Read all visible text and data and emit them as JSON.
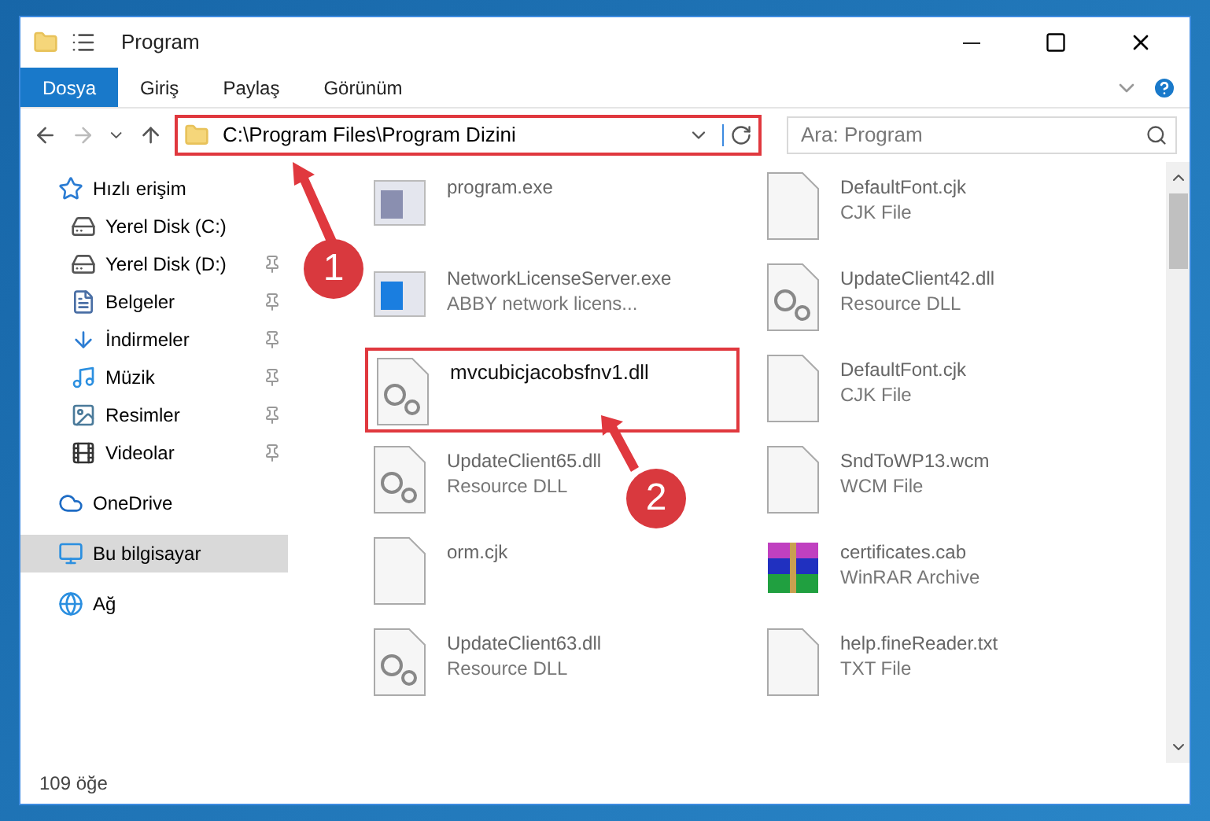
{
  "window": {
    "title": "Program"
  },
  "ribbon_tabs": [
    {
      "label": "Dosya",
      "selected": true
    },
    {
      "label": "Giriş",
      "selected": false
    },
    {
      "label": "Paylaş",
      "selected": false
    },
    {
      "label": "Görünüm",
      "selected": false
    }
  ],
  "address": {
    "path": "C:\\Program Files\\Program Dizini"
  },
  "search": {
    "placeholder": "Ara: Program"
  },
  "sidebar": {
    "items": [
      {
        "label": "Hızlı erişim",
        "kind": "star",
        "selected": false,
        "children": [
          {
            "label": "Yerel Disk (C:)",
            "kind": "drive",
            "pinned": false,
            "selected": false
          },
          {
            "label": "Yerel Disk (D:)",
            "kind": "drive",
            "pinned": true,
            "selected": false
          },
          {
            "label": "Belgeler",
            "kind": "docs",
            "pinned": true,
            "selected": false
          },
          {
            "label": "İndirmeler",
            "kind": "download",
            "pinned": true,
            "selected": false
          },
          {
            "label": "Müzik",
            "kind": "music",
            "pinned": true,
            "selected": false
          },
          {
            "label": "Resimler",
            "kind": "pictures",
            "pinned": true,
            "selected": false
          },
          {
            "label": "Videolar",
            "kind": "video",
            "pinned": true,
            "selected": false
          }
        ]
      },
      {
        "label": "OneDrive",
        "kind": "cloud",
        "selected": false
      },
      {
        "label": "Bu bilgisayar",
        "kind": "pc",
        "selected": true
      },
      {
        "label": "Ağ",
        "kind": "network",
        "selected": false
      }
    ]
  },
  "files": [
    {
      "name": "program.exe",
      "kind": "exe",
      "highlighted": false
    },
    {
      "name": "DefaultFont.cjk",
      "type": "CJK File",
      "kind": "blank",
      "highlighted": false
    },
    {
      "name": "NetworkLicenseServer.exe",
      "type": "ABBY network licens...",
      "kind": "app",
      "highlighted": false
    },
    {
      "name": "UpdateClient42.dll",
      "type": "Resource DLL",
      "kind": "dll",
      "highlighted": false
    },
    {
      "name": "mvcubicjacobsfnv1.dll",
      "kind": "dll",
      "highlighted": true
    },
    {
      "name": "DefaultFont.cjk",
      "type": "CJK File",
      "kind": "blank",
      "highlighted": false
    },
    {
      "name": "UpdateClient65.dll",
      "type": "Resource DLL",
      "kind": "dll",
      "highlighted": false
    },
    {
      "name": "SndToWP13.wcm",
      "type": "WCM File",
      "kind": "blank",
      "highlighted": false
    },
    {
      "name": "orm.cjk",
      "kind": "blank",
      "highlighted": false
    },
    {
      "name": "certificates.cab",
      "type": "WinRAR Archive",
      "kind": "archive",
      "highlighted": false
    },
    {
      "name": "UpdateClient63.dll",
      "type": "Resource DLL",
      "kind": "dll",
      "highlighted": false
    },
    {
      "name": "help.fineReader.txt",
      "type": "TXT File",
      "kind": "blank",
      "highlighted": false
    }
  ],
  "status_bar": {
    "count": "109 öğe"
  },
  "annotations": [
    {
      "number": "1"
    },
    {
      "number": "2"
    }
  ]
}
